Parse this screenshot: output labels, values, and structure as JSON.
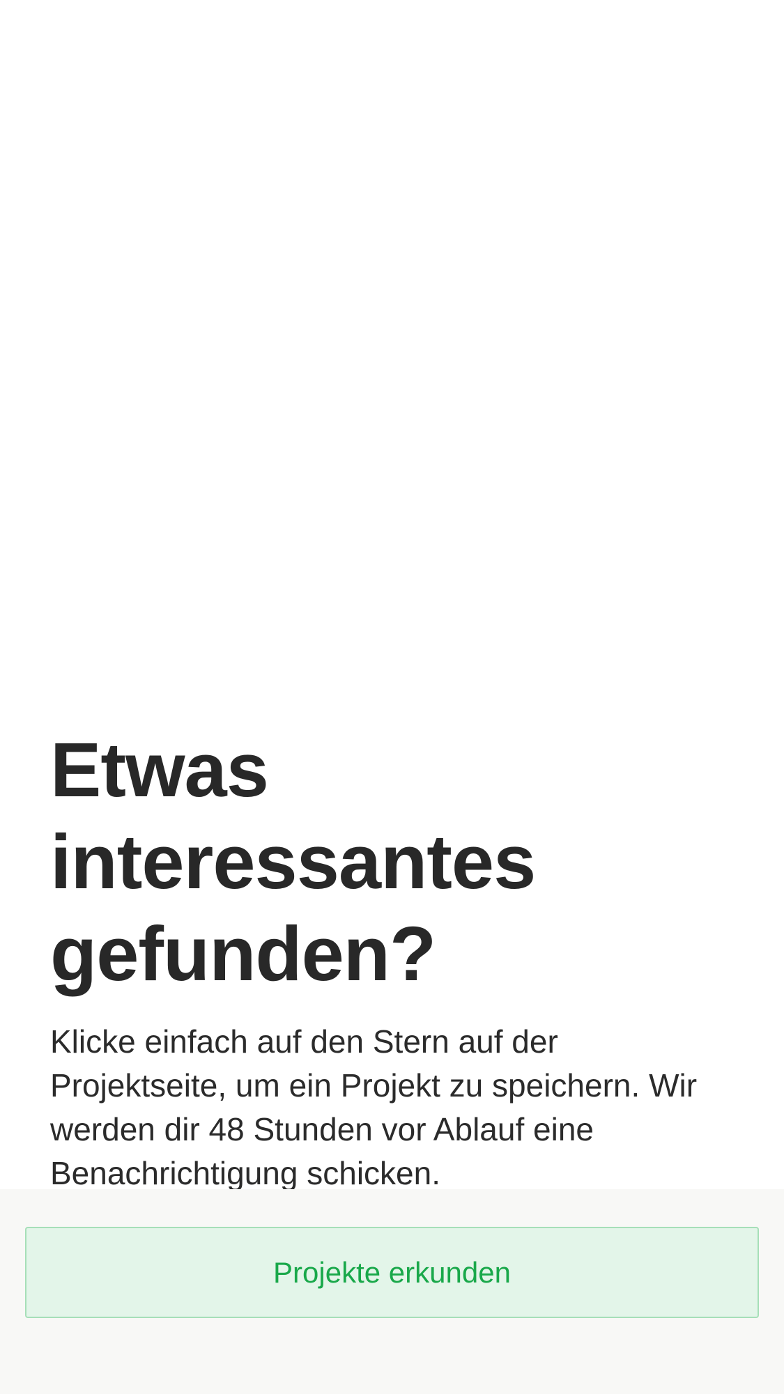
{
  "empty_state": {
    "headline": "Etwas interessantes gefunden?",
    "body": "Klicke einfach auf den Stern auf der Projektseite, um ein Projekt zu speichern. Wir werden dir 48 Stunden vor Ablauf eine Benachrichtigung schicken."
  },
  "footer": {
    "cta_label": "Projekte erkunden"
  },
  "colors": {
    "headline": "#282828",
    "body_text": "#2b2b2b",
    "footer_background": "#f8f8f6",
    "button_background": "#e3f5e9",
    "button_border": "#a6dfb8",
    "button_text": "#19a84a"
  }
}
